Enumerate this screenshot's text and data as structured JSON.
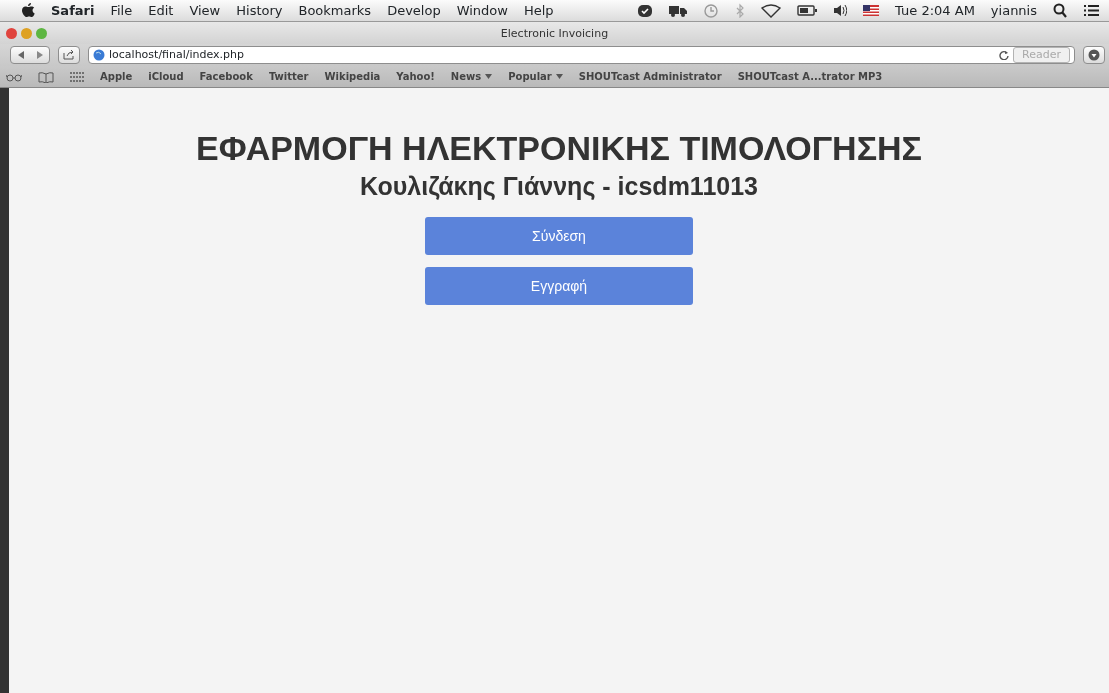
{
  "menubar": {
    "app": "Safari",
    "menus": [
      "File",
      "Edit",
      "View",
      "History",
      "Bookmarks",
      "Develop",
      "Window",
      "Help"
    ],
    "clock": "Tue 2:04 AM",
    "user": "yiannis"
  },
  "window": {
    "title": "Electronic Invoicing"
  },
  "toolbar": {
    "address": "localhost/final/index.php",
    "reader": "Reader"
  },
  "bookmarks": [
    {
      "label": "Apple",
      "kind": "link"
    },
    {
      "label": "iCloud",
      "kind": "link"
    },
    {
      "label": "Facebook",
      "kind": "link"
    },
    {
      "label": "Twitter",
      "kind": "link"
    },
    {
      "label": "Wikipedia",
      "kind": "link"
    },
    {
      "label": "Yahoo!",
      "kind": "link"
    },
    {
      "label": "News",
      "kind": "menu"
    },
    {
      "label": "Popular",
      "kind": "menu"
    },
    {
      "label": "SHOUTcast Administrator",
      "kind": "link"
    },
    {
      "label": "SHOUTcast A...trator MP3",
      "kind": "link"
    }
  ],
  "page": {
    "title": "ΕΦΑΡΜΟΓΗ ΗΛΕΚΤΡΟΝΙΚΗΣ ΤΙΜΟΛΟΓΗΣΗΣ",
    "subtitle": "Κουλιζάκης Γιάννης - icsdm11013",
    "buttons": [
      "Σύνδεση",
      "Εγγραφή"
    ]
  }
}
